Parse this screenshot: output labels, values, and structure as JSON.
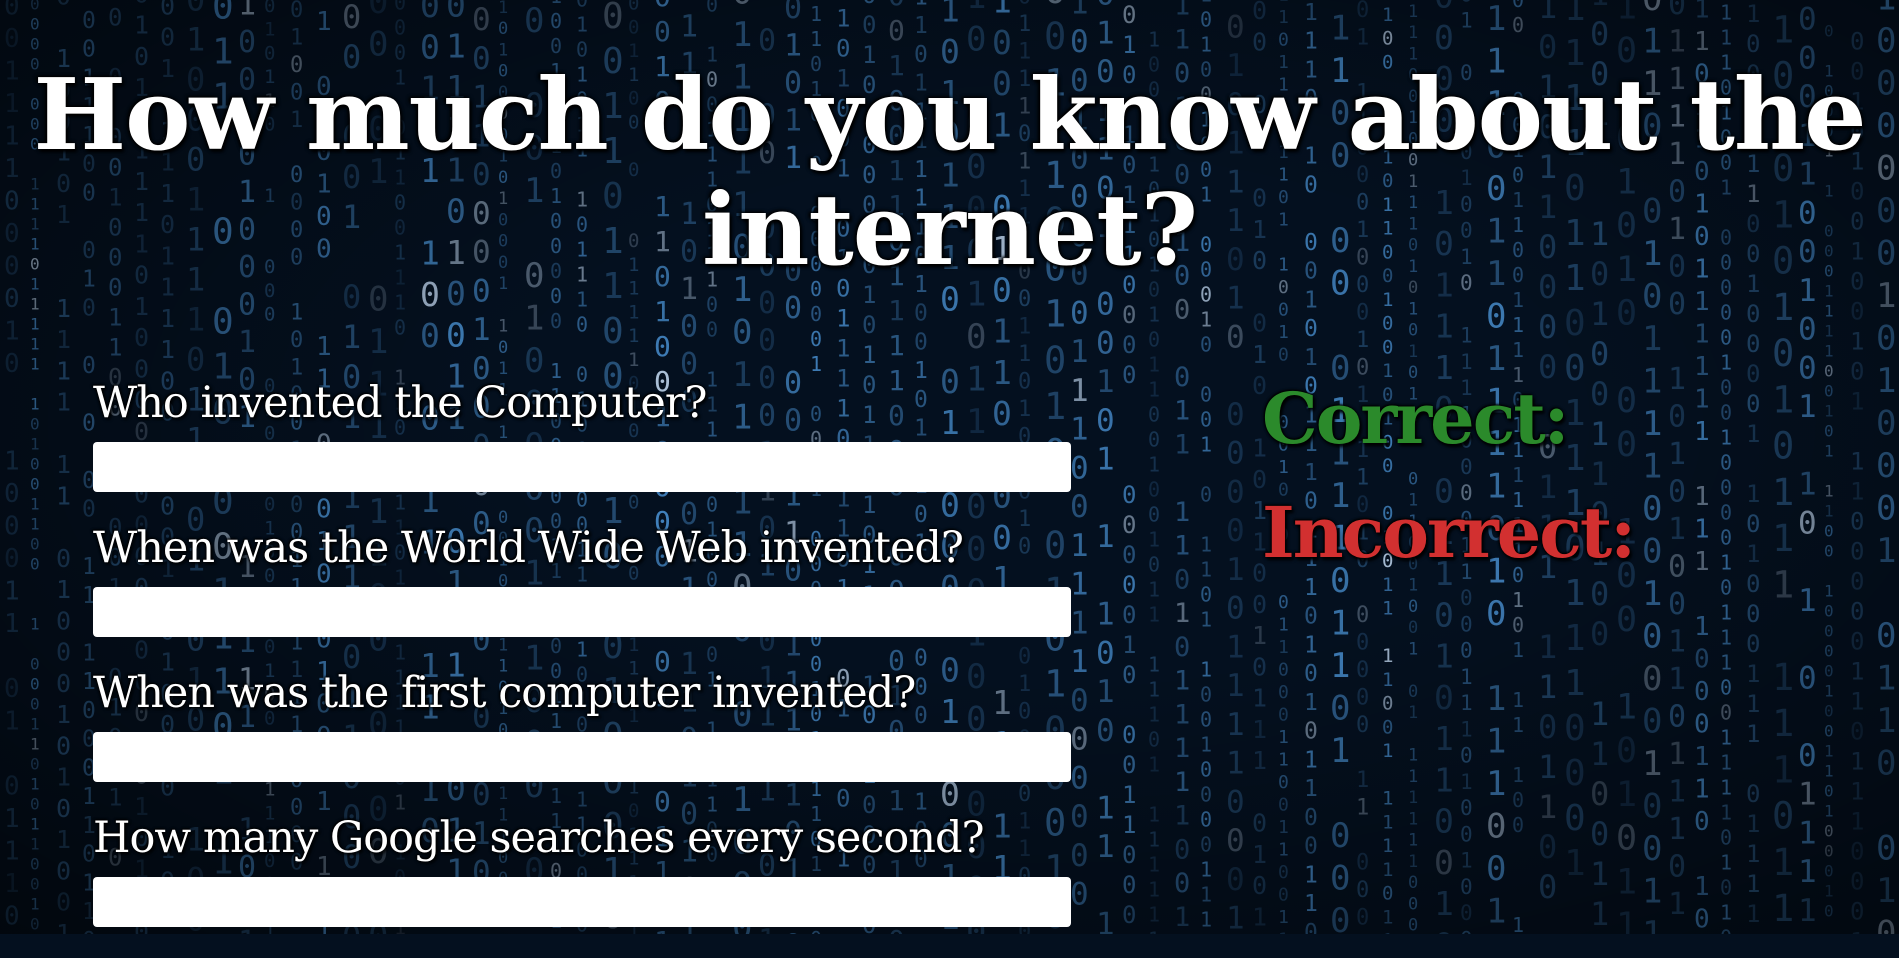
{
  "page": {
    "title": "How much do you know about the internet?"
  },
  "quiz": {
    "questions": [
      {
        "label": "Who invented the Computer?",
        "value": ""
      },
      {
        "label": "When was the World Wide Web invented?",
        "value": ""
      },
      {
        "label": "When was the first computer invented?",
        "value": ""
      },
      {
        "label": "How many Google searches every second?",
        "value": ""
      }
    ]
  },
  "score": {
    "correct_label": "Correct:",
    "incorrect_label": "Incorrect:"
  },
  "colors": {
    "correct": "#2b8a2b",
    "incorrect": "#d23030",
    "background": "#04101f",
    "matrix_glyph": "#4f9be0"
  },
  "background": {
    "style": "binary-matrix-rain",
    "glyphs": [
      "0",
      "1"
    ]
  }
}
